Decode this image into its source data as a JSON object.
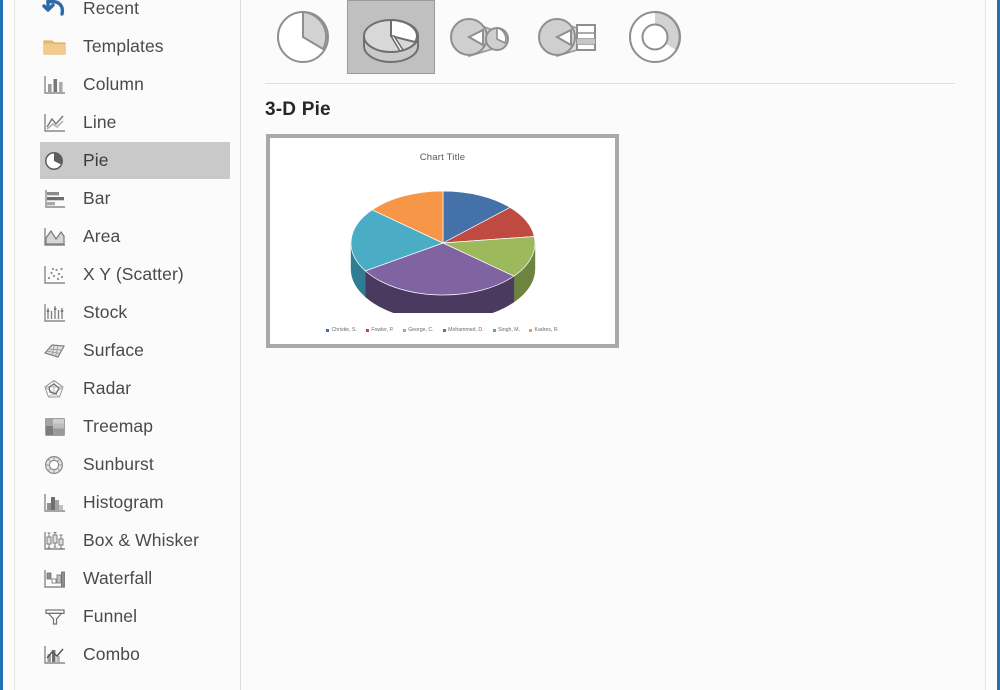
{
  "dialog": {
    "accent_border_color": "#2372b8",
    "background": "#fbfbfb"
  },
  "sidebar": {
    "selected_index": 4,
    "items": [
      {
        "label": "Recent",
        "icon": "recent-undo-arrow-icon"
      },
      {
        "label": "Templates",
        "icon": "templates-folder-icon"
      },
      {
        "label": "Column",
        "icon": "column-chart-icon"
      },
      {
        "label": "Line",
        "icon": "line-chart-icon"
      },
      {
        "label": "Pie",
        "icon": "pie-chart-icon"
      },
      {
        "label": "Bar",
        "icon": "bar-chart-icon"
      },
      {
        "label": "Area",
        "icon": "area-chart-icon"
      },
      {
        "label": "X Y (Scatter)",
        "icon": "scatter-chart-icon"
      },
      {
        "label": "Stock",
        "icon": "stock-chart-icon"
      },
      {
        "label": "Surface",
        "icon": "surface-chart-icon"
      },
      {
        "label": "Radar",
        "icon": "radar-chart-icon"
      },
      {
        "label": "Treemap",
        "icon": "treemap-chart-icon"
      },
      {
        "label": "Sunburst",
        "icon": "sunburst-chart-icon"
      },
      {
        "label": "Histogram",
        "icon": "histogram-chart-icon"
      },
      {
        "label": "Box & Whisker",
        "icon": "box-whisker-chart-icon"
      },
      {
        "label": "Waterfall",
        "icon": "waterfall-chart-icon"
      },
      {
        "label": "Funnel",
        "icon": "funnel-chart-icon"
      },
      {
        "label": "Combo",
        "icon": "combo-chart-icon"
      }
    ]
  },
  "chart_type_row": {
    "selected_index": 1,
    "buttons": [
      {
        "name": "pie",
        "icon": "pie-subtype-icon",
        "tooltip": "Pie"
      },
      {
        "name": "pie-3d",
        "icon": "pie-3d-subtype-icon",
        "tooltip": "3-D Pie"
      },
      {
        "name": "pie-of-pie",
        "icon": "pie-of-pie-subtype-icon",
        "tooltip": "Pie of Pie"
      },
      {
        "name": "bar-of-pie",
        "icon": "bar-of-pie-subtype-icon",
        "tooltip": "Bar of Pie"
      },
      {
        "name": "doughnut",
        "icon": "doughnut-subtype-icon",
        "tooltip": "Doughnut"
      }
    ]
  },
  "preview": {
    "heading": "3-D Pie"
  },
  "chart_data": {
    "type": "pie",
    "title": "Chart Title",
    "three_d": true,
    "legend_position": "bottom",
    "categories": [
      "Christie, S.",
      "Fowler, P.",
      "George, C.",
      "Mohammed, D.",
      "Singh, M.",
      "Kadres, R."
    ],
    "values": [
      13,
      10,
      13,
      30,
      20,
      14
    ],
    "colors": [
      "#4472a8",
      "#bf4a41",
      "#9cba5c",
      "#8064a2",
      "#4bacc6",
      "#f79646"
    ],
    "side_colors": [
      "#2f5480",
      "#8f3731",
      "#6d8340",
      "#4b3a60",
      "#2f7d92",
      "#b46b2c"
    ],
    "xlabel": "",
    "ylabel": "",
    "grid": false
  }
}
